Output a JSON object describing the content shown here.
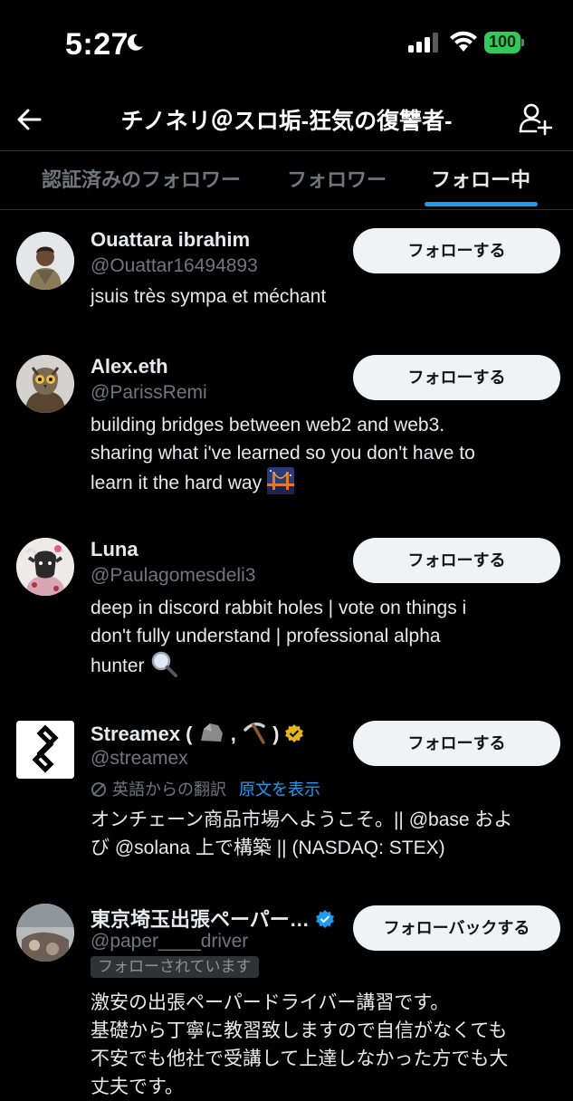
{
  "status_bar": {
    "time": "5:27",
    "battery": "100"
  },
  "header": {
    "title": "チノネリ＠スロ垢-狂気の復讐者-"
  },
  "tabs": [
    {
      "label": "認証済みのフォロワー"
    },
    {
      "label": "フォロワー"
    },
    {
      "label": "フォロー中"
    }
  ],
  "users": [
    {
      "name": "Ouattara ibrahim",
      "handle": "@Ouattar16494893",
      "bio_lines": [
        "jsuis très sympa et méchant"
      ],
      "button": "フォローする"
    },
    {
      "name": "Alex.eth",
      "handle": "@ParissRemi",
      "bio_lines": [
        "building bridges between web2 and web3.",
        "sharing what i've learned so you don't have to",
        "learn it the hard way"
      ],
      "button": "フォローする"
    },
    {
      "name": "Luna",
      "handle": "@Paulagomesdeli3",
      "bio_lines": [
        "deep in discord rabbit holes | vote on things i",
        "don't fully understand | professional alpha",
        "hunter"
      ],
      "button": "フォローする"
    },
    {
      "name_prefix": "Streamex ( ",
      "name_mid": " , ",
      "name_suffix": " )",
      "handle": "@streamex",
      "translated_from": "英語からの翻訳",
      "show_original": "原文を表示",
      "bio_lines": [
        "オンチェーン商品市場へようこそ。|| @base およ",
        "び @solana 上で構築 || (NASDAQ: STEX)"
      ],
      "button": "フォローする"
    },
    {
      "name": "東京埼玉出張ペーパー…",
      "handle": "@paper____driver",
      "follows_you": "フォローされています",
      "bio_lines": [
        "激安の出張ペーパードライバー講習です。",
        "基礎から丁寧に教習致しますので自信がなくても",
        "不安でも他社で受講して上達しなかった方でも大",
        "丈夫です。"
      ],
      "button": "フォローバックする"
    }
  ],
  "colors": {
    "accent": "#1d9bf0",
    "verified_gold": "#e2b719",
    "battery": "#34c759"
  }
}
